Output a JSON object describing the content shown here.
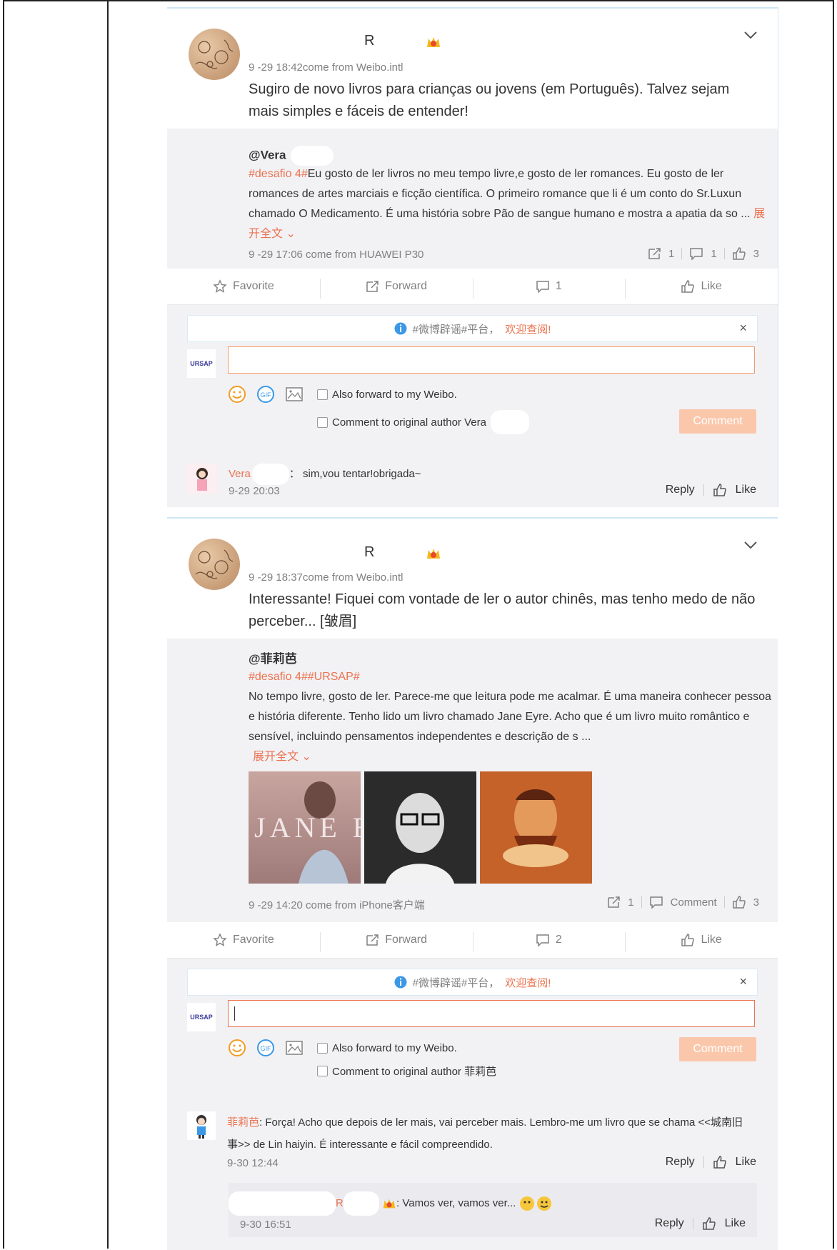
{
  "posts": [
    {
      "user": "R",
      "meta": "9 -29 18:42come from Weibo.intl",
      "text": "Sugiro de novo livros para crianças ou jovens (em Português). Talvez sejam mais simples e fáceis de entender!",
      "quote": {
        "user": "@Vera",
        "tag": "#desafio 4#",
        "text": "Eu gosto de ler livros no meu tempo livre,e gosto de ler romances. Eu gosto de ler romances de artes marciais e ficção científica. O primeiro romance que li é um conto do Sr.Luxun chamado O Medicamento. É uma história  sobre Pão de sangue humano e mostra a apatia da so ...",
        "more": "展开全文",
        "meta": "9 -29 17:06 come from HUAWEI P30",
        "stats": {
          "forward": "1",
          "comment": "1",
          "like": "3"
        }
      },
      "actions": {
        "favorite": "Favorite",
        "forward": "Forward",
        "comment": "1",
        "like": "Like"
      },
      "notice": {
        "text": "#微博辟谣#平台，",
        "link": "欢迎查阅!"
      },
      "avatar_label": "URSAP",
      "options": {
        "forward": "Also forward to my Weibo.",
        "original": "Comment to original author Vera"
      },
      "comment_btn": "Comment",
      "replies": [
        {
          "name": "Vera",
          "text": "sim,vou tentar!obrigada~",
          "time": "9-29 20:03",
          "reply": "Reply",
          "like": "Like"
        }
      ]
    },
    {
      "user": "R",
      "meta": "9 -29 18:37come from Weibo.intl",
      "text": "Interessante! Fiquei  com vontade de ler o autor chinês, mas tenho medo de não perceber... [皱眉]",
      "quote": {
        "user": "@菲莉芭",
        "tag": "#desafio 4##URSAP#",
        "text": "No tempo livre, gosto de ler. Parece-me que leitura pode me acalmar. É uma maneira conhecer pessoa e história diferente. Tenho lido um livro chamado Jane Eyre. Acho que é um livro muito romântico e sensível, incluindo pensamentos independentes e descrição de s ...",
        "more": "展开全文",
        "images": [
          "JANE EYRE",
          "portrait",
          "painting"
        ],
        "meta": "9 -29 14:20 come from iPhone客户端",
        "stats": {
          "forward": "1",
          "comment": "Comment",
          "like": "3"
        }
      },
      "actions": {
        "favorite": "Favorite",
        "forward": "Forward",
        "comment": "2",
        "like": "Like"
      },
      "notice": {
        "text": "#微博辟谣#平台，",
        "link": "欢迎查阅!"
      },
      "avatar_label": "URSAP",
      "options": {
        "forward": "Also forward to my Weibo.",
        "original": "Comment to original author 菲莉芭"
      },
      "comment_btn": "Comment",
      "replies": [
        {
          "name": "菲莉芭",
          "text": "Força! Acho que depois de ler mais, vai perceber mais. Lembro-me um livro que se chama <<城南旧事>> de Lin haiyin. É interessante e fácil compreendido.",
          "time": "9-30 12:44",
          "reply": "Reply",
          "like": "Like"
        },
        {
          "name": "R",
          "text": "Vamos ver, vamos ver...",
          "time": "9-30 16:51",
          "reply": "Reply",
          "like": "Like"
        }
      ]
    }
  ]
}
